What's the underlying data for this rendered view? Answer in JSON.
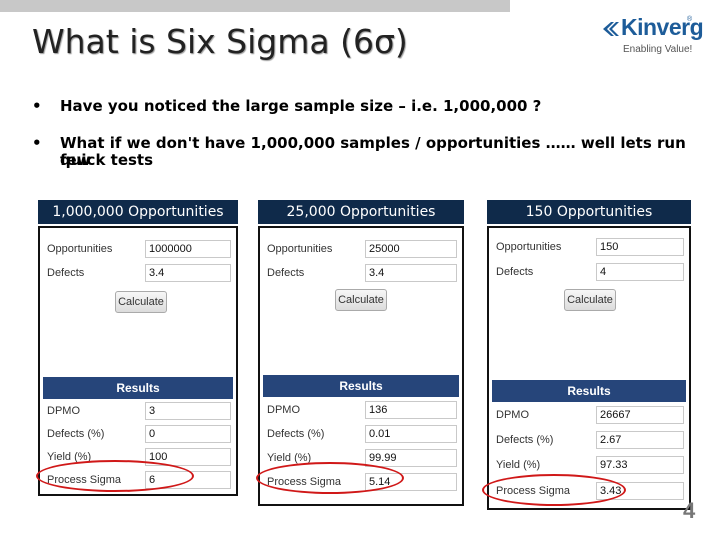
{
  "slide": {
    "title": "What is Six Sigma (6σ)",
    "page_number": "4"
  },
  "logo": {
    "name": "Kinverg",
    "registered": "®",
    "tagline": "Enabling Value!",
    "colors": {
      "brand": "#1d5c99"
    }
  },
  "bullets": [
    {
      "dot": "•",
      "text": "Have you noticed the large sample size – i.e. 1,000,000 ?"
    },
    {
      "dot": "•",
      "text": "What if we don't have 1,000,000 samples / opportunities …… well lets run few",
      "text2": "quick tests"
    }
  ],
  "columns": [
    {
      "header": "1,000,000 Opportunities",
      "inputs": {
        "opportunities_label": "Opportunities",
        "opportunities_value": "1000000",
        "defects_label": "Defects",
        "defects_value": "3.4"
      },
      "calculate_label": "Calculate",
      "results_label": "Results",
      "results": [
        {
          "label": "DPMO",
          "value": "3"
        },
        {
          "label": "Defects (%)",
          "value": "0"
        },
        {
          "label": "Yield (%)",
          "value": "100"
        },
        {
          "label": "Process Sigma",
          "value": "6"
        }
      ]
    },
    {
      "header": "25,000 Opportunities",
      "inputs": {
        "opportunities_label": "Opportunities",
        "opportunities_value": "25000",
        "defects_label": "Defects",
        "defects_value": "3.4"
      },
      "calculate_label": "Calculate",
      "results_label": "Results",
      "results": [
        {
          "label": "DPMO",
          "value": "136"
        },
        {
          "label": "Defects (%)",
          "value": "0.01"
        },
        {
          "label": "Yield (%)",
          "value": "99.99"
        },
        {
          "label": "Process Sigma",
          "value": "5.14"
        }
      ]
    },
    {
      "header": "150 Opportunities",
      "inputs": {
        "opportunities_label": "Opportunities",
        "opportunities_value": "150",
        "defects_label": "Defects",
        "defects_value": "4"
      },
      "calculate_label": "Calculate",
      "results_label": "Results",
      "results": [
        {
          "label": "DPMO",
          "value": "26667"
        },
        {
          "label": "Defects (%)",
          "value": "2.67"
        },
        {
          "label": "Yield (%)",
          "value": "97.33"
        },
        {
          "label": "Process Sigma",
          "value": "3.43"
        }
      ]
    }
  ],
  "colors": {
    "header_bg": "#0f2a4a",
    "results_bar": "#26457a",
    "highlight": "#d01818"
  }
}
